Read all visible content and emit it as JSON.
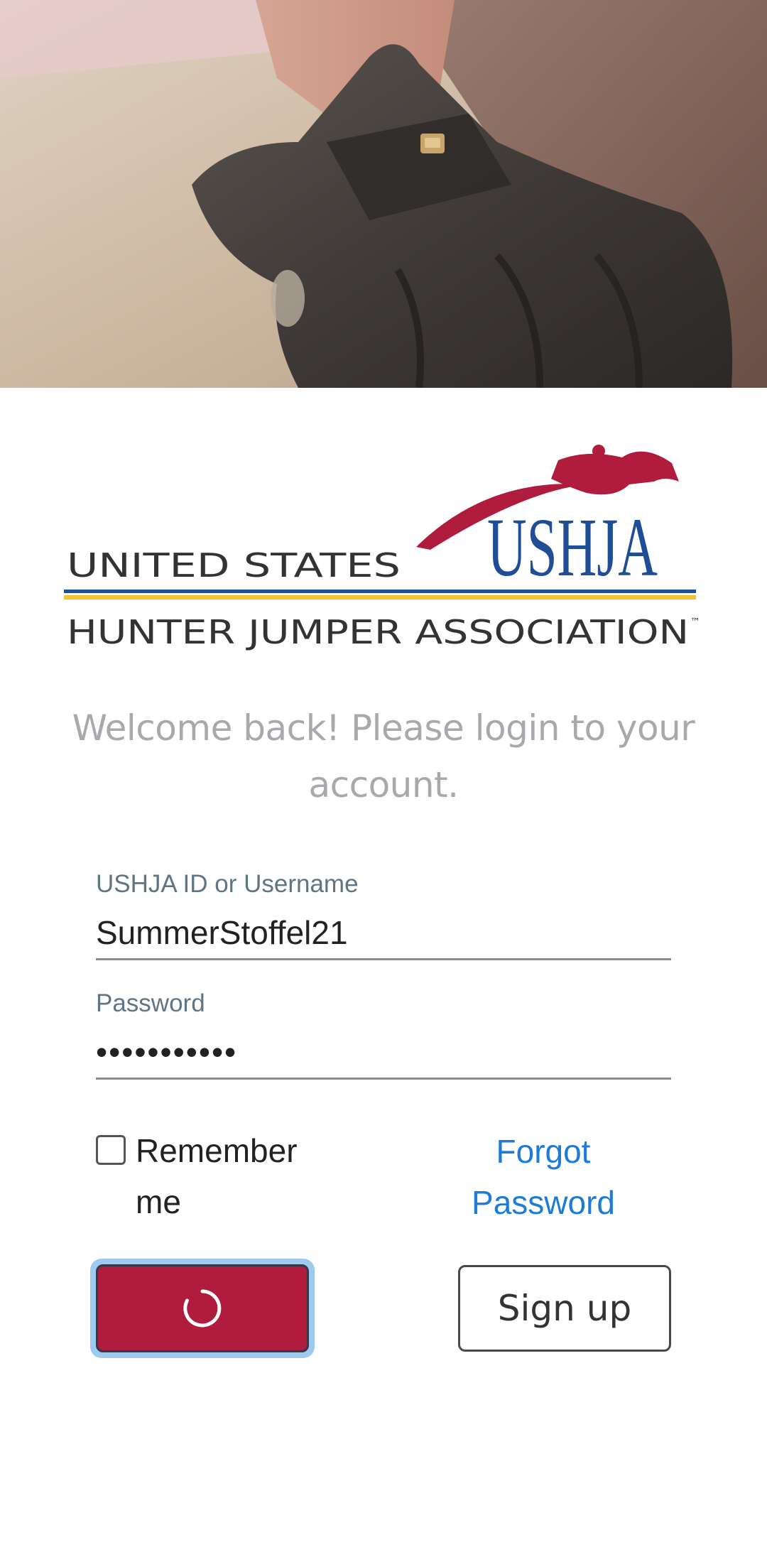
{
  "logo": {
    "line1": "UNITED STATES",
    "line2": "HUNTER JUMPER ASSOCIATION",
    "mark": "USHJA",
    "tm": "™",
    "colors": {
      "navy": "#1f4e96",
      "red": "#b01c3e",
      "gold": "#f2c230",
      "text": "#333333"
    }
  },
  "welcome": "Welcome back! Please login to your account.",
  "form": {
    "username_label": "USHJA ID or Username",
    "username_value": "SummerStoffel21",
    "password_label": "Password",
    "password_value": "•••••••••••",
    "remember_label": "Remember me",
    "forgot_label": "Forgot Password"
  },
  "buttons": {
    "signup_label": "Sign up",
    "login_state": "loading-spinner-icon"
  },
  "colors": {
    "primary": "#b01c3e",
    "focus_ring": "#9fcaf0",
    "link": "#1e7bd6",
    "label": "#5f7584"
  }
}
